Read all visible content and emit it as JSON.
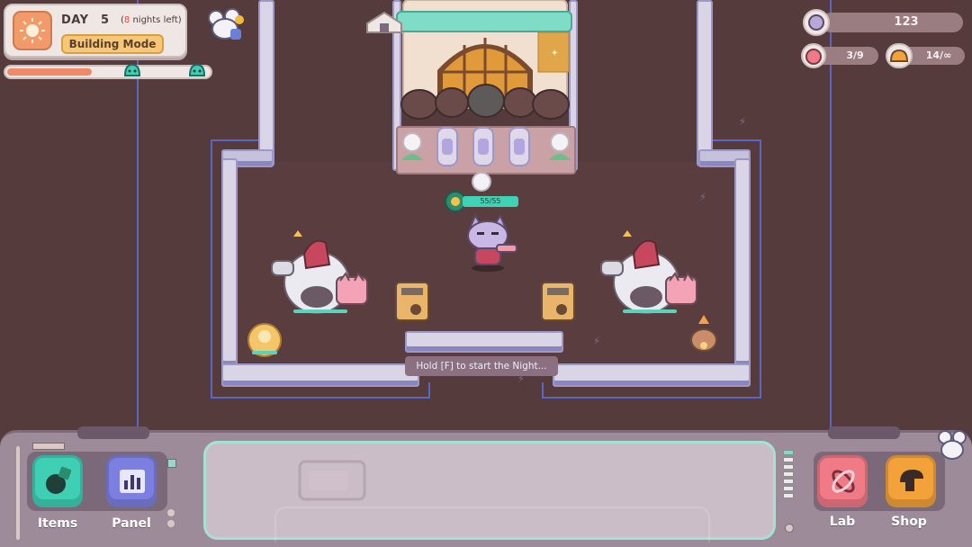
{
  "hud": {
    "day_label": "DAY",
    "day_number": "5",
    "nights_left_count": "8",
    "nights_left_text": " nights left)",
    "nights_left_open": "(",
    "mode_label": "Building Mode",
    "day_progress": 0.42
  },
  "resources": {
    "currency": "123",
    "pets": "3/9",
    "units": "14/∞"
  },
  "player": {
    "health": "55/55",
    "health_fraction": 1.0
  },
  "hint": "Hold [F] to start the Night...",
  "toolbar": {
    "left": [
      {
        "label": "Items",
        "icon": "bomb-icon",
        "color": "#3fcfb4"
      },
      {
        "label": "Panel",
        "icon": "bar-chart-icon",
        "color": "#7d7fe0"
      }
    ],
    "right": [
      {
        "label": "Lab",
        "icon": "atom-icon",
        "color": "#f07a86"
      },
      {
        "label": "Shop",
        "icon": "shop-icon",
        "color": "#f3a23a"
      }
    ]
  },
  "colors": {
    "accent_teal": "#58d4bd",
    "wire_blue": "#5b66c4",
    "floor": "#553b3c",
    "highlight_red": "#e04a4a"
  }
}
